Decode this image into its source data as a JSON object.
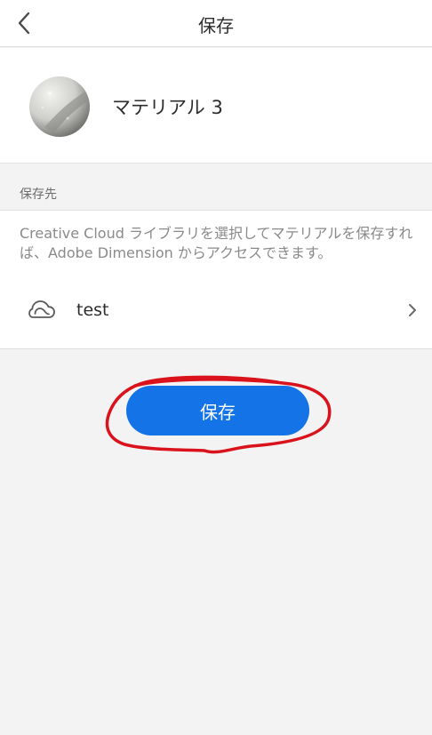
{
  "header": {
    "title": "保存",
    "back_icon": "chevron-left-icon"
  },
  "material": {
    "name": "マテリアル 3",
    "thumbnail_icon": "material-sphere-thumbnail"
  },
  "destination": {
    "section_label": "保存先",
    "description": "Creative Cloud ライブラリを選択してマテリアルを保存すれば、Adobe Dimension からアクセスできます。",
    "library_name": "test",
    "library_icon": "creative-cloud-icon",
    "chevron_icon": "chevron-right-icon"
  },
  "actions": {
    "save_label": "保存"
  },
  "colors": {
    "accent": "#1473e6",
    "annotation": "#d9121b",
    "background": "#f3f3f3"
  }
}
